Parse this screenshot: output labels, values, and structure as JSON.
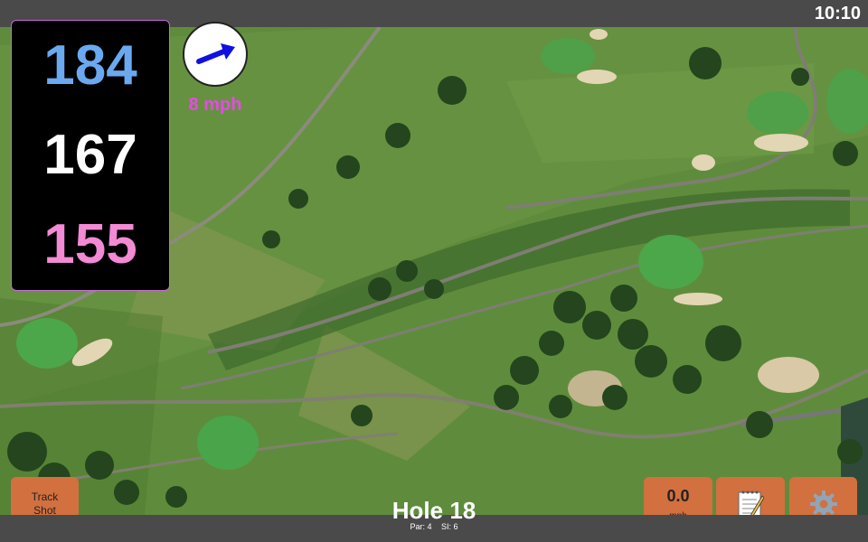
{
  "status_bar": {
    "time": "10:10"
  },
  "distances": {
    "back": "184",
    "middle": "167",
    "front": "155"
  },
  "wind": {
    "speed": "8 mph"
  },
  "hole": {
    "title": "Hole 18",
    "par": "Par: 4",
    "si": "SI: 6"
  },
  "buttons": {
    "track_shot": "Track Shot",
    "speed_value": "0.0",
    "speed_unit": "mph",
    "notes_icon": "notepad-icon",
    "settings_icon": "gear-icon"
  },
  "colors": {
    "back_distance": "#6aa9ef",
    "middle_distance": "#ffffff",
    "front_distance": "#f28ad4",
    "wind_speed": "#e64be6",
    "button": "#d2703f",
    "panel_border": "#c46ad6"
  }
}
